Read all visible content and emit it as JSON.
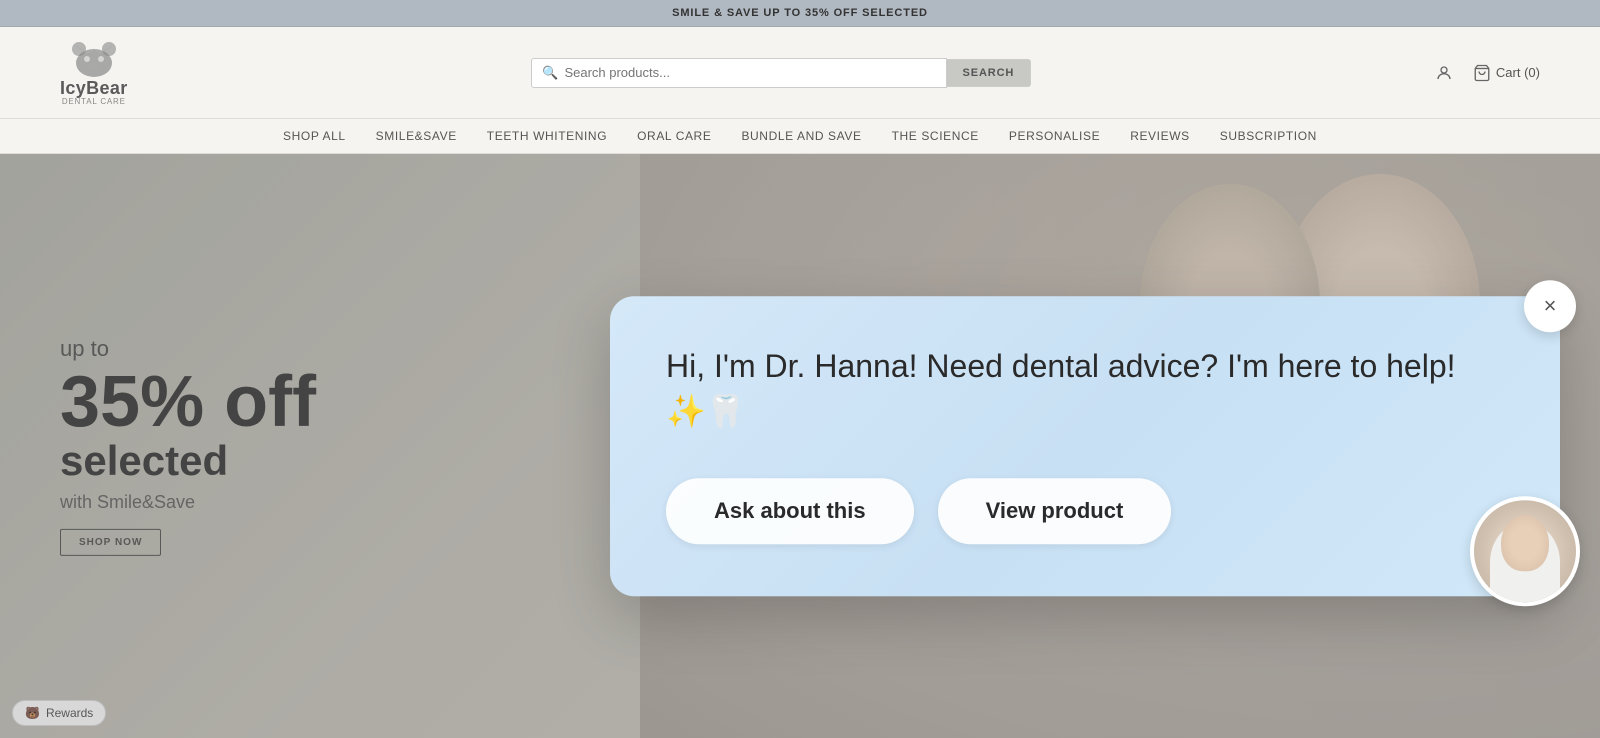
{
  "announcement": {
    "text": "SMILE & SAVE UP TO 35% OFF SELECTED"
  },
  "header": {
    "logo_name": "IcyBear",
    "logo_sub": "Dental Care",
    "search_placeholder": "Search products...",
    "search_button_label": "SEARCH",
    "cart_label": "Cart (0)"
  },
  "nav": {
    "items": [
      {
        "label": "SHOP ALL"
      },
      {
        "label": "SMILE&SAVE"
      },
      {
        "label": "TEETH WHITENING"
      },
      {
        "label": "ORAL CARE"
      },
      {
        "label": "BUNDLE AND SAVE"
      },
      {
        "label": "THE SCIENCE"
      },
      {
        "label": "PERSONALISE"
      },
      {
        "label": "REVIEWS"
      },
      {
        "label": "SUBSCRIPTION"
      }
    ]
  },
  "hero": {
    "up_to": "up to",
    "discount": "35% off",
    "selected": "selected",
    "with": "with Smile&Save",
    "shop_now": "SHOP NOW",
    "rewards": "Rewards"
  },
  "chat_popup": {
    "message": "Hi, I'm Dr. Hanna! Need dental advice? I'm here to help! ✨🦷",
    "ask_button": "Ask about this",
    "view_button": "View product",
    "close_label": "×"
  }
}
